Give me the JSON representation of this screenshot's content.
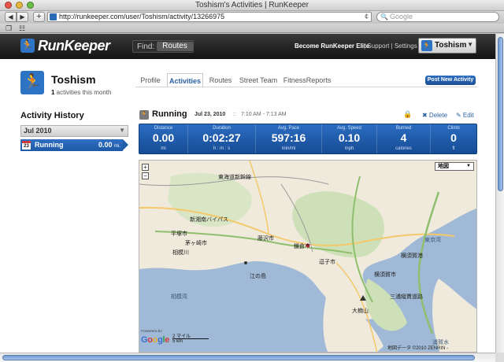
{
  "window": {
    "title": "Toshism's Activities | RunKeeper"
  },
  "toolbar": {
    "back_label": "◀",
    "forward_label": "▶",
    "add_label": "+",
    "url": "http://runkeeper.com/user/Toshism/activity/13266975",
    "reload_label": "¢",
    "search_placeholder": "Google"
  },
  "bookmarks": {
    "book_label": "❐",
    "grid_label": "☷"
  },
  "header": {
    "logo_mark": "🏃",
    "logo_text": "RunKeeper",
    "find_label": "Find:",
    "find_button": "Routes",
    "elite_link": "Become RunKeeper Elite",
    "links": "| Support | Settings",
    "user_name": "Toshism",
    "user_caret": "▼"
  },
  "profile": {
    "avatar_mark": "🏃",
    "name": "Toshism",
    "activities_count": "1",
    "activities_text": " activities this month",
    "tabs": [
      {
        "label": "Profile"
      },
      {
        "label": "Activities"
      },
      {
        "label": "Routes"
      },
      {
        "label": "Street Team"
      },
      {
        "label": "FitnessReports"
      }
    ],
    "post_button": "Post New Activity"
  },
  "sidebar": {
    "title": "Activity History",
    "month": "Jul 2010",
    "month_caret": "▼",
    "activity": {
      "day": "23",
      "name": "Running",
      "value": "0.00",
      "unit": "mi."
    }
  },
  "activity": {
    "icon": "🏃",
    "title": "Running",
    "date": "Jul 23, 2010",
    "separator": "::",
    "time": "7:10 AM - 7:13 AM",
    "lock_icon": "🔒",
    "delete_label": "✖ Delete",
    "edit_label": "✎ Edit"
  },
  "stats": [
    {
      "label": "Distance",
      "value": "0.00",
      "unit": "mi"
    },
    {
      "label": "Duration",
      "value": "0:02:27",
      "unit": "h : m : s"
    },
    {
      "label": "Avg. Pace",
      "value": "597:16",
      "unit": "min/mi"
    },
    {
      "label": "Avg. Speed",
      "value": "0.10",
      "unit": "mph"
    },
    {
      "label": "Burned",
      "value": "4",
      "unit": "calories"
    },
    {
      "label": "Climb",
      "value": "0",
      "unit": "ft"
    }
  ],
  "map": {
    "type_select": "地図",
    "type_caret": "▼",
    "zoom_in": "+",
    "zoom_out": "−",
    "labels": [
      "東海道新幹線",
      "平塚市",
      "茅ヶ崎市",
      "相模川",
      "藤沢市",
      "鎌倉市",
      "逗子市",
      "江の島",
      "横須賀市",
      "東京湾",
      "横須賀港",
      "相模湾",
      "大楠山",
      "浦賀水",
      "三浦縦貫道路",
      "新湘南バイパス"
    ],
    "powered_by": "POWERED BY",
    "google": [
      "G",
      "o",
      "o",
      "g",
      "l",
      "e"
    ],
    "scale_mi": "2 マイル",
    "scale_km": "5 km",
    "copyright": "地図データ ©2010 ZENRIN -"
  },
  "colors": {
    "brand_blue": "#2d74c4",
    "header_black": "#131313",
    "link_blue": "#2a5fa5"
  }
}
